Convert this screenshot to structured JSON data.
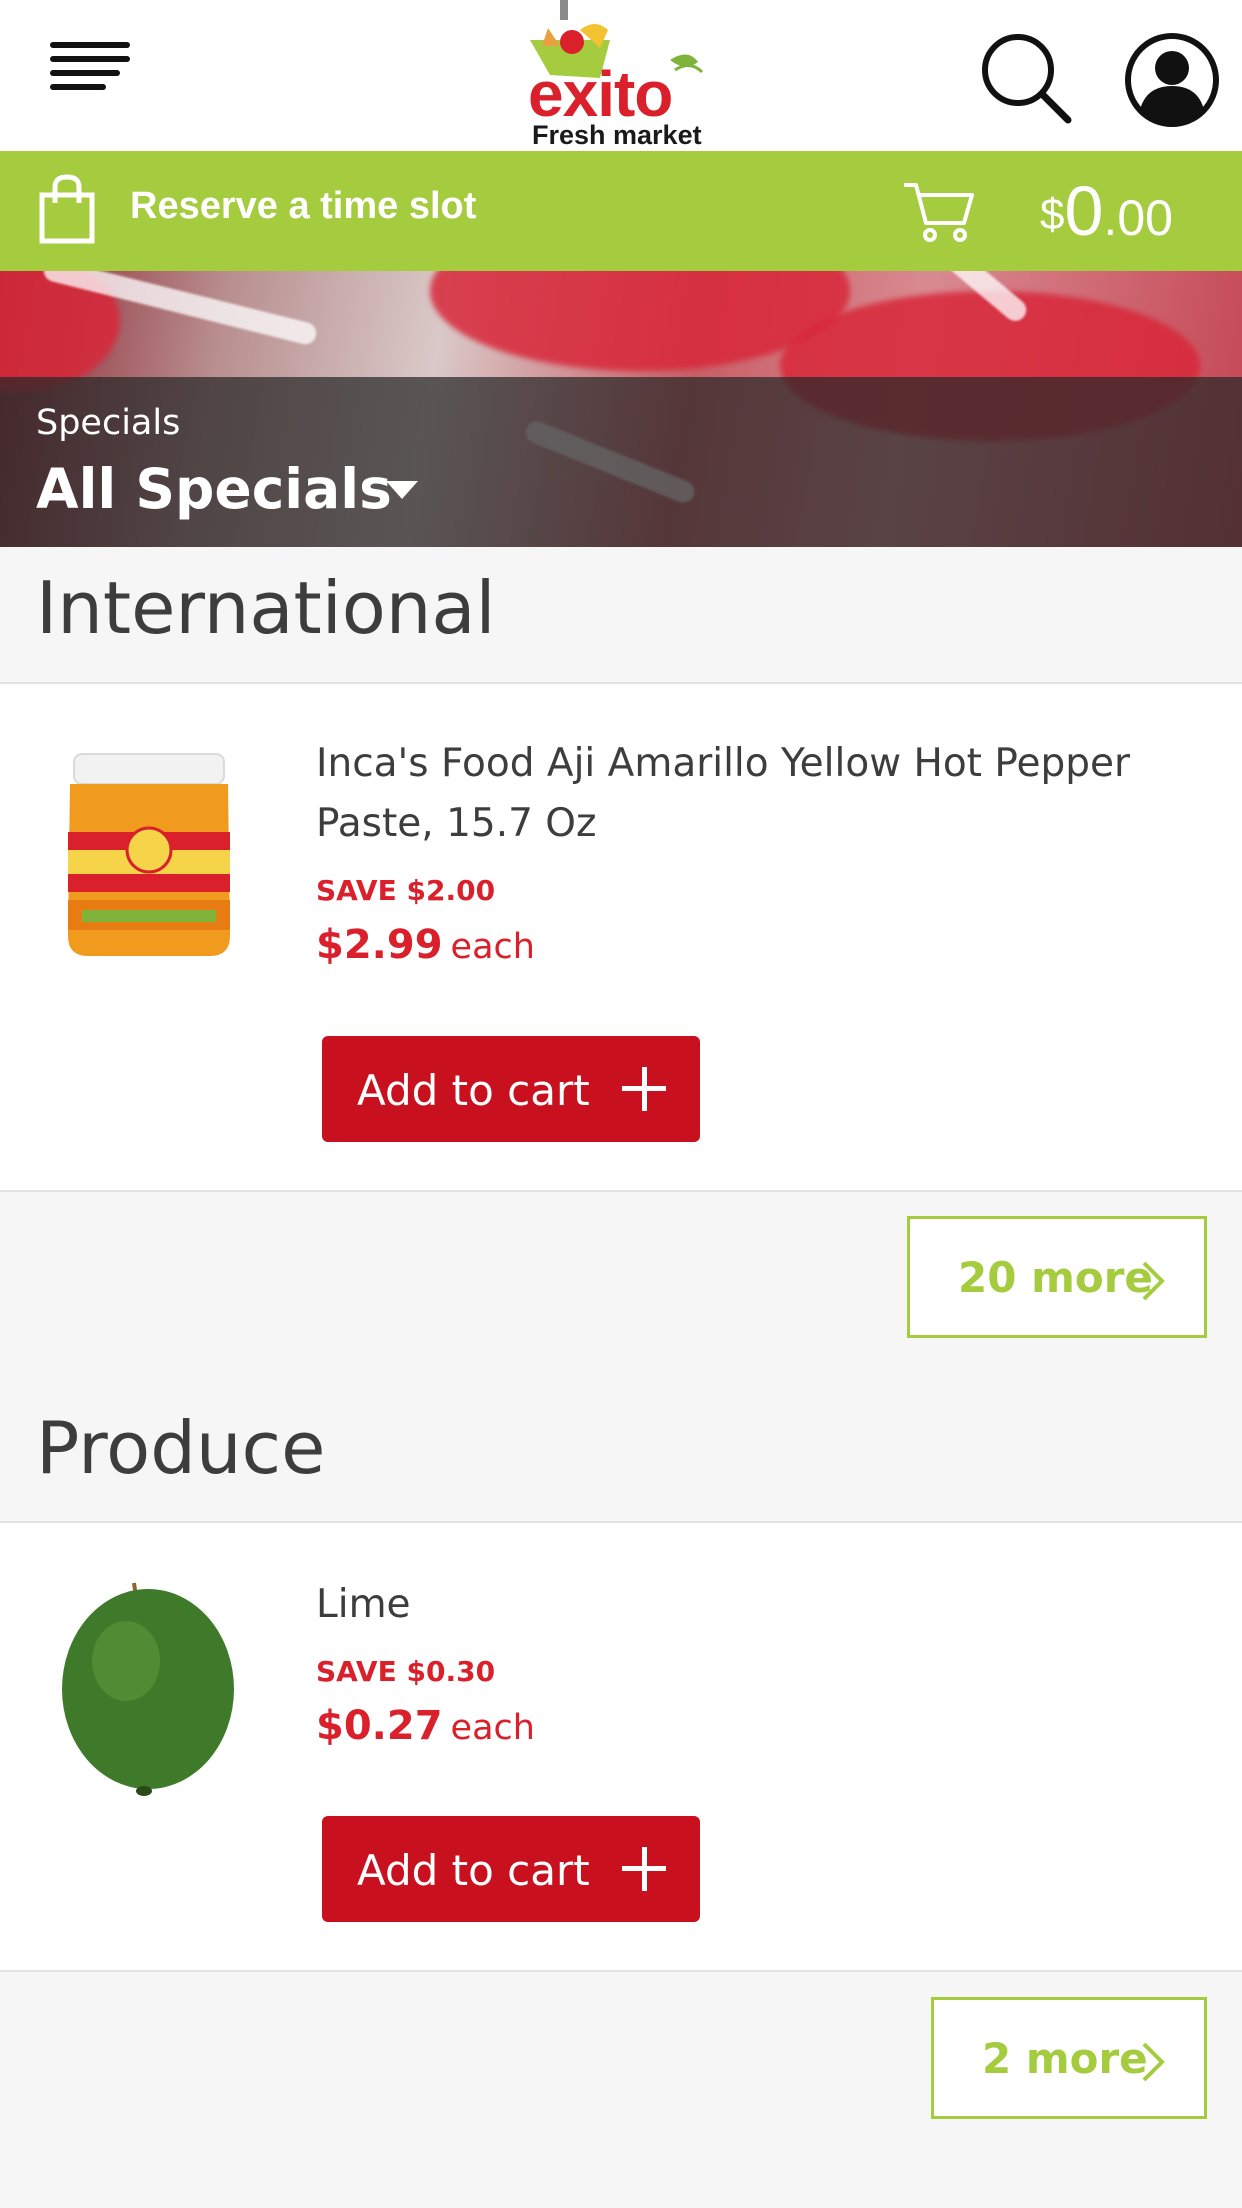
{
  "header": {
    "logo_text": "exito",
    "logo_subtext": "Fresh market"
  },
  "green_bar": {
    "reserve_label": "Reserve a time slot",
    "cart_currency": "$",
    "cart_dollars": "0",
    "cart_cents": ".00"
  },
  "banner": {
    "label": "Specials",
    "selected": "All Specials"
  },
  "sections": [
    {
      "title": "International",
      "product": {
        "name": "Inca's Food Aji Amarillo Yellow Hot Pepper Paste, 15.7 Oz",
        "save": "SAVE $2.00",
        "price": "$2.99",
        "unit": "each",
        "add_label": "Add to cart"
      },
      "more_label": "20 more"
    },
    {
      "title": "Produce",
      "product": {
        "name": "Lime",
        "save": "SAVE $0.30",
        "price": "$0.27",
        "unit": "each",
        "add_label": "Add to cart"
      },
      "more_label": "2 more"
    }
  ],
  "colors": {
    "brand_red": "#d9202b",
    "button_red": "#c8101e",
    "accent_green": "#a5cc3e"
  }
}
